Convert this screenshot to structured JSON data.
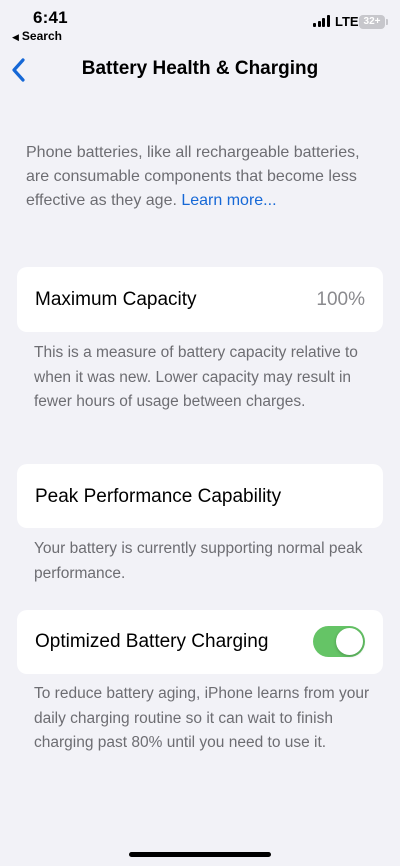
{
  "status_bar": {
    "time": "6:41",
    "back_label": "Search",
    "network": "LTE",
    "battery": "32+"
  },
  "nav": {
    "title": "Battery Health & Charging"
  },
  "intro": {
    "text": "Phone batteries, like all rechargeable batteries, are consumable components that become less effective as they age. ",
    "link": "Learn more..."
  },
  "maximum_capacity": {
    "label": "Maximum Capacity",
    "value": "100%",
    "footer": "This is a measure of battery capacity relative to when it was new. Lower capacity may result in fewer hours of usage between charges."
  },
  "peak_performance": {
    "label": "Peak Performance Capability",
    "footer": "Your battery is currently supporting normal peak performance."
  },
  "optimized_charging": {
    "label": "Optimized Battery Charging",
    "enabled": true,
    "footer": "To reduce battery aging, iPhone learns from your daily charging routine so it can wait to finish charging past 80% until you need to use it."
  },
  "colors": {
    "accent": "#1668d6",
    "toggle_on": "#65c466",
    "background": "#f2f2f7"
  }
}
